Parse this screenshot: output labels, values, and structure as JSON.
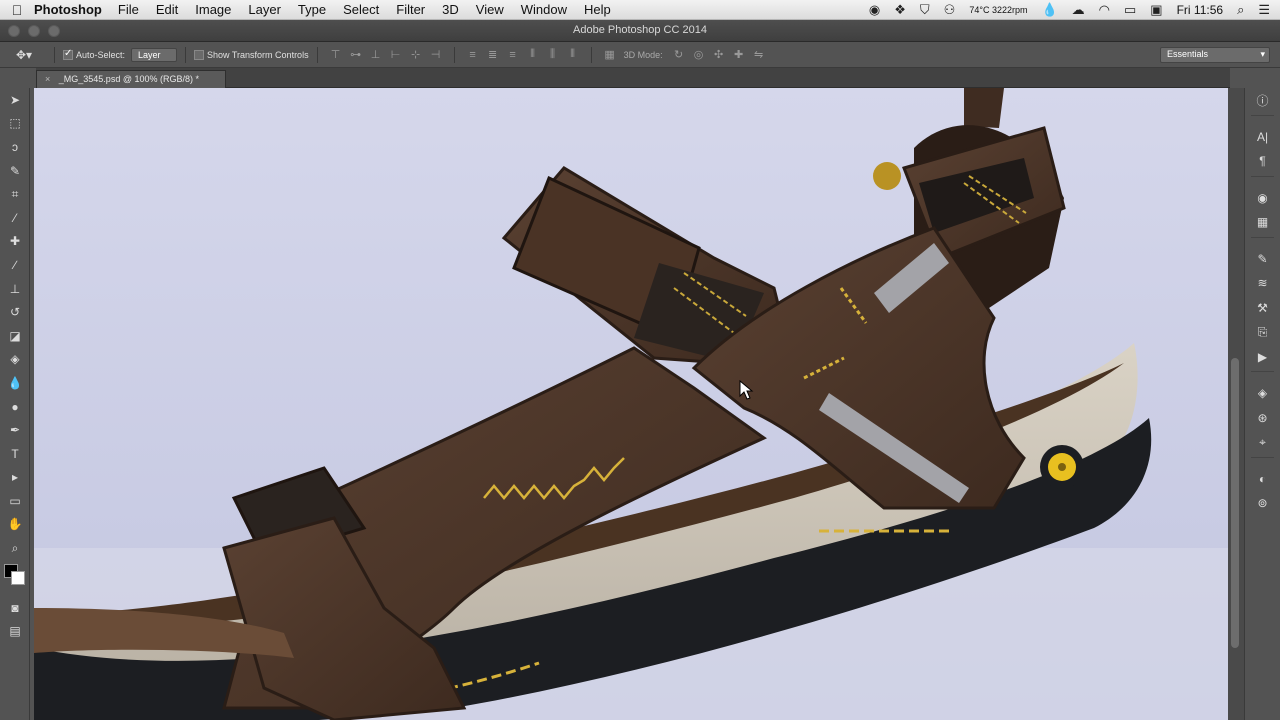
{
  "menubar": {
    "apple": "",
    "app_name": "Photoshop",
    "items": [
      "File",
      "Edit",
      "Image",
      "Layer",
      "Type",
      "Select",
      "Filter",
      "3D",
      "View",
      "Window",
      "Help"
    ],
    "status": {
      "temp": "74°C 3222rpm",
      "clock": "Fri 11:56"
    },
    "icons": [
      "record-icon",
      "dropbox-icon",
      "shield-icon",
      "glasses-icon",
      "drop-icon",
      "cloud-icon",
      "wifi-icon",
      "battery-icon",
      "display-icon",
      "search-icon",
      "list-icon"
    ]
  },
  "window": {
    "title": "Adobe Photoshop CC 2014"
  },
  "options": {
    "auto_select_label": "Auto-Select:",
    "auto_select_value": "Layer",
    "show_transform_label": "Show Transform Controls",
    "mode3d_label": "3D Mode:",
    "workspace": "Essentials"
  },
  "document": {
    "tab_label": "_MG_3545.psd @ 100% (RGB/8) *"
  },
  "colors": {
    "canvas_bg": "#c8cbe4",
    "foreground": "#000000",
    "background": "#ffffff"
  }
}
